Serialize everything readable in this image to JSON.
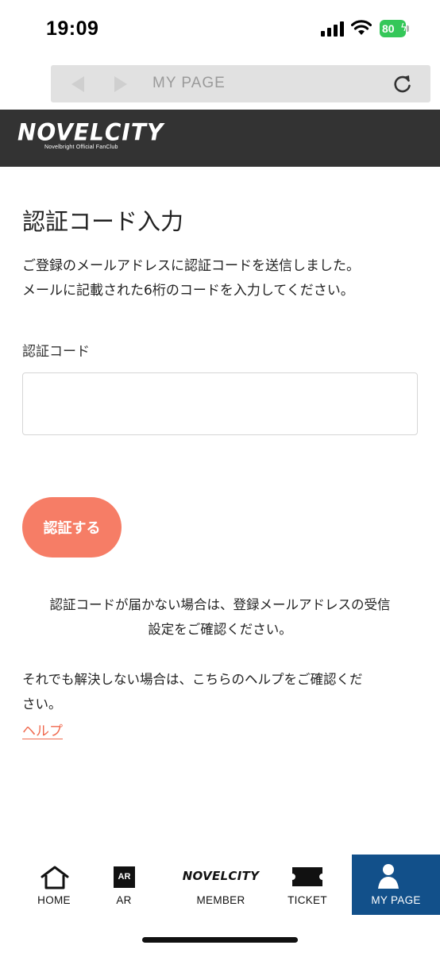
{
  "status_bar": {
    "time": "19:09",
    "battery": "80",
    "battery_color": "#35c759"
  },
  "browser": {
    "title": "MY PAGE",
    "back_icon": "chevron-left-icon",
    "forward_icon": "chevron-right-icon",
    "reload_icon": "reload-icon"
  },
  "header": {
    "logo": "NOVELCITY",
    "logo_sub": "Novelbright Official FanClub",
    "background": "#333333"
  },
  "main": {
    "title": "認証コード入力",
    "description_line1": "ご登録のメールアドレスに認証コードを送信しました。",
    "description_line2": "メールに記載された6桁のコードを入力してください。",
    "field_label": "認証コード",
    "field_value": "",
    "field_placeholder": "",
    "submit_label": "認証する",
    "accent_color": "#f67d66",
    "notice_line1": "認証コードが届かない場合は、登録メールアドレスの受信",
    "notice_line2": "設定をご確認ください。",
    "help_text_line1": "それでも解決しない場合は、こちらのヘルプをご確認くだ",
    "help_text_line2": "さい。",
    "help_link": "ヘルプ"
  },
  "tab_bar": {
    "active_color": "#12508a",
    "items": [
      {
        "label": "HOME",
        "icon": "home-icon"
      },
      {
        "label": "AR",
        "icon": "ar-icon",
        "icon_text": "AR"
      },
      {
        "label": "MEMBER",
        "icon": "novelcity-logo",
        "icon_text": "NOVELCITY"
      },
      {
        "label": "TICKET",
        "icon": "ticket-icon"
      },
      {
        "label": "MY PAGE",
        "icon": "user-icon",
        "active": true
      }
    ]
  }
}
